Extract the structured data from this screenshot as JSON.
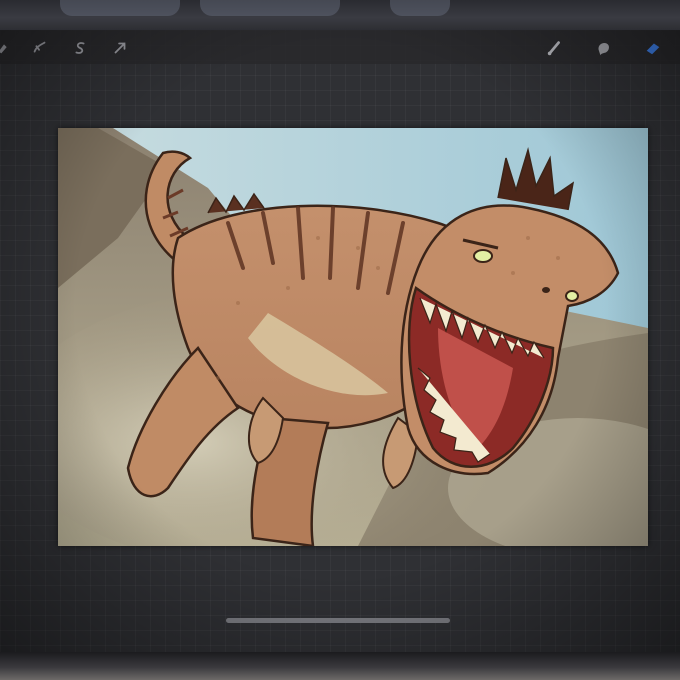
{
  "app": {
    "window_title": "",
    "accent_color": "#3d7fe8"
  },
  "toolbar": {
    "left_tools": [
      {
        "icon": "modify-icon"
      },
      {
        "icon": "selection-icon"
      },
      {
        "icon": "transform-s-icon"
      },
      {
        "icon": "arrow-icon"
      }
    ],
    "right_tools": [
      {
        "icon": "brush-icon"
      },
      {
        "icon": "smudge-icon"
      },
      {
        "icon": "eraser-icon",
        "active": true
      }
    ]
  },
  "canvas": {
    "artwork": "t-rex-illustration"
  }
}
